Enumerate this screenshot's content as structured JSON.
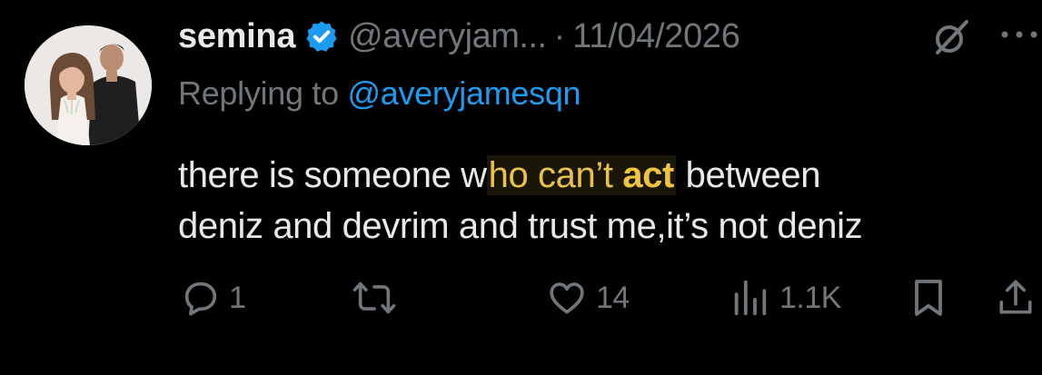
{
  "tweet": {
    "author": {
      "display_name": "semina",
      "handle": "@averyjam...",
      "verified": true
    },
    "separator": "·",
    "timestamp": "11/04/2026",
    "replying_to": {
      "prefix": "Replying to",
      "mention": "@averyjamesqn"
    },
    "text": {
      "part1": "there is someone w",
      "highlight_a": "ho can’t ",
      "highlight_b": "act",
      "part2": " between",
      "line2": "deniz and devrim and trust me,it’s not deniz"
    },
    "actions": {
      "replies": "1",
      "reposts": "",
      "likes": "14",
      "views": "1.1K"
    }
  },
  "icons": {
    "verified": "verified-badge-icon",
    "grok": "grok-icon",
    "more": "more-icon",
    "reply": "reply-icon",
    "repost": "repost-icon",
    "like": "heart-icon",
    "views": "views-icon",
    "bookmark": "bookmark-icon",
    "share": "share-icon"
  },
  "colors": {
    "background": "#000000",
    "primary_text": "#e7e9ea",
    "secondary_text": "#71767b",
    "link": "#1d9bf0",
    "highlight": "#f0c53d",
    "verified": "#1d9bf0"
  }
}
